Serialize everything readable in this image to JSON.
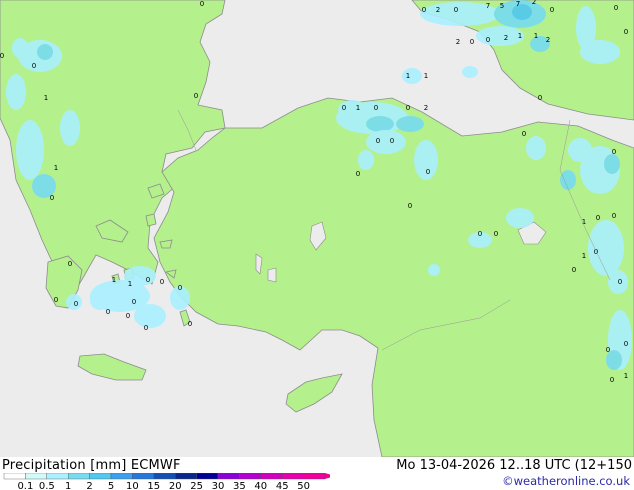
{
  "legend": {
    "title": "Precipitation [mm]",
    "model": "ECMWF",
    "ticks": [
      "0.1",
      "0.5",
      "1",
      "2",
      "5",
      "10",
      "15",
      "20",
      "25",
      "30",
      "35",
      "40",
      "45",
      "50"
    ],
    "colors": [
      "#ffffff",
      "#d2fafa",
      "#aaf0ff",
      "#78dcf0",
      "#50c8f0",
      "#3ca0f0",
      "#2878dc",
      "#1450b4",
      "#0a288c",
      "#000096",
      "#8c00dc",
      "#b400d2",
      "#d200be",
      "#e600aa",
      "#f0009b"
    ]
  },
  "valid_time": "Mo 13-04-2026 12..18 UTC (12+150",
  "credit": "©weatheronline.co.uk",
  "colors": {
    "land": "#b4f08c",
    "sea": "#ececec",
    "coast": "#8c8c8c"
  },
  "point_values": [
    "0",
    "2",
    "0",
    "7",
    "5",
    "7",
    "2",
    "0",
    "0",
    "2",
    "0",
    "0",
    "2",
    "1",
    "1",
    "2",
    "0",
    "0",
    "0",
    "0",
    "1",
    "0",
    "1",
    "1",
    "0",
    "1",
    "0",
    "0",
    "2",
    "0",
    "0",
    "0",
    "0",
    "1",
    "0",
    "0",
    "0",
    "0",
    "0",
    "0",
    "1",
    "0",
    "0",
    "1",
    "0",
    "0",
    "0",
    "0",
    "0",
    "0",
    "1",
    "1",
    "0",
    "0",
    "0",
    "0",
    "0",
    "0",
    "0",
    "0",
    "0",
    "0",
    "0",
    "1",
    "0"
  ]
}
